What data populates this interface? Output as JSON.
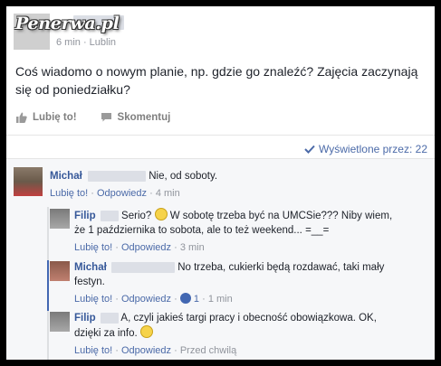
{
  "watermark": "Penerwa.pl",
  "post": {
    "meta": "6 min · Lublin",
    "text": "Coś wiadomo o nowym planie, np. gdzie go znaleźć? Zajęcia zaczynają się od poniedziałku?",
    "like_label": "Lubię to!",
    "comment_label": "Skomentuj",
    "seen_label": "Wyświetlone przez: 22"
  },
  "comments": [
    {
      "name": "Michał",
      "text": "Nie, od soboty.",
      "like": "Lubię to!",
      "reply": "Odpowiedz",
      "time": "4 min"
    },
    {
      "name": "Filip",
      "text1": "Serio?",
      "text2": "W sobotę trzeba być na UMCSie??? Niby wiem,",
      "text3": "że 1 października to sobota, ale to też weekend... =__=",
      "like": "Lubię to!",
      "reply": "Odpowiedz",
      "time": "3 min"
    },
    {
      "name": "Michał",
      "text1": "No trzeba, cukierki będą rozdawać, taki mały",
      "text2": "festyn.",
      "like": "Lubię to!",
      "reply": "Odpowiedz",
      "likes_count": "1",
      "time": "1 min"
    },
    {
      "name": "Filip",
      "text1": "A, czyli jakieś targi pracy i obecność obowiązkowa. OK,",
      "text2": "dzięki za info.",
      "like": "Lubię to!",
      "reply": "Odpowiedz",
      "time": "Przed chwilą"
    }
  ],
  "colors": {
    "link": "#365899",
    "sub_link": "#4b6aa8",
    "meta": "#90949c",
    "active_thread": "#4267b2"
  }
}
